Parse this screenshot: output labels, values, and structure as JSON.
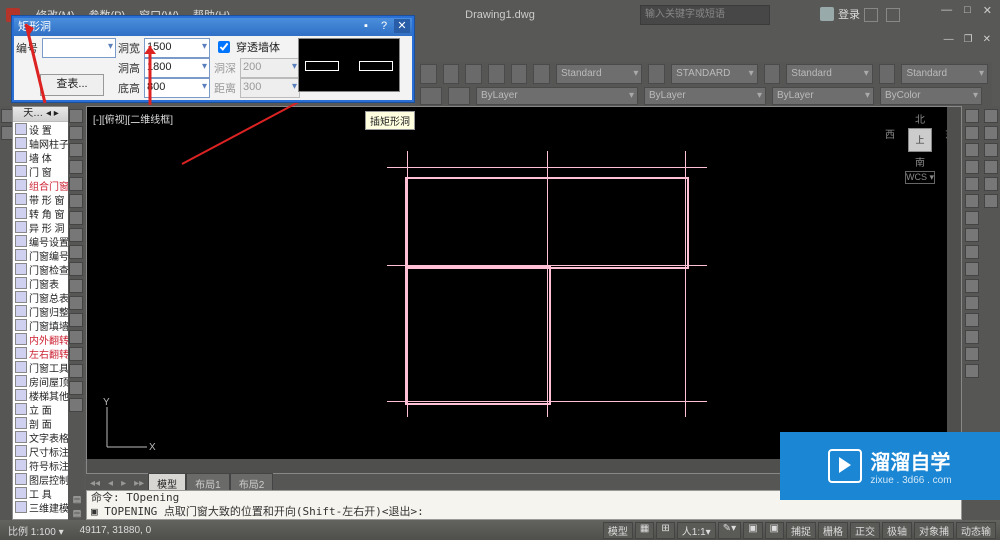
{
  "window": {
    "title": "Drawing1.dwg",
    "search_placeholder": "输入关键字或短语",
    "login": "登录"
  },
  "menus": [
    "修改(M)",
    "参数(P)",
    "窗口(W)",
    "帮助(H)"
  ],
  "dialog": {
    "title": "矩形洞",
    "labels": {
      "number": "编号",
      "width": "洞宽",
      "height": "洞高",
      "sill": "底高",
      "depth": "洞深",
      "dist": "距离"
    },
    "values": {
      "number": "",
      "width": "1500",
      "height": "1800",
      "sill": "800",
      "depth": "200",
      "dist": "300"
    },
    "checkbox": "穿透墙体",
    "button": "查表..."
  },
  "tooltip": "插矩形洞",
  "viewport_label": "[-][俯视][二维线框]",
  "compass": {
    "n": "北",
    "s": "南",
    "e": "东",
    "w": "西",
    "top": "上",
    "wcs": "WCS ▾"
  },
  "ucs_labels": {
    "x": "X",
    "y": "Y"
  },
  "styles": [
    "Standard",
    "STANDARD",
    "Standard",
    "Standard"
  ],
  "layers": [
    "ByLayer",
    "ByLayer",
    "ByLayer",
    "ByColor"
  ],
  "tabs": {
    "nav": [
      "◂◂",
      "◂",
      "▸",
      "▸▸"
    ],
    "model": "模型",
    "layout1": "布局1",
    "layout2": "布局2"
  },
  "command": {
    "line1": "命令: TOpening",
    "prompt_icon": "▣",
    "line2": "TOPENING 点取门窗大致的位置和开向(Shift-左右开)<退出>:"
  },
  "status": {
    "scale": "比例 1:100 ▾",
    "coords": "49117, 31880, 0",
    "right": [
      "模型",
      "▦",
      "⊞",
      "人1:1▾",
      "✎▾",
      "▣",
      "▣",
      "捕捉",
      "栅格",
      "正交",
      "极轴",
      "对象捕",
      "动态输"
    ]
  },
  "tree": {
    "header": "天…  ◂ ▸",
    "items": [
      {
        "a": "设",
        "b": "置"
      },
      {
        "a": "轴网柱子",
        "b": ""
      },
      {
        "a": "墙",
        "b": "体"
      },
      {
        "a": "门",
        "b": "窗"
      },
      {
        "a": "组合门窗",
        "b": "",
        "r": true
      },
      {
        "a": "带 形 窗",
        "b": ""
      },
      {
        "a": "转 角 窗",
        "b": ""
      },
      {
        "a": "异 形 洞",
        "b": ""
      },
      {
        "a": "编号设置",
        "b": ""
      },
      {
        "a": "门窗编号",
        "b": ""
      },
      {
        "a": "门窗检查",
        "b": ""
      },
      {
        "a": "门窗表",
        "b": ""
      },
      {
        "a": "门窗总表",
        "b": ""
      },
      {
        "a": "门窗归整",
        "b": ""
      },
      {
        "a": "门窗填墙",
        "b": ""
      },
      {
        "a": "内外翻转",
        "b": "",
        "r": true
      },
      {
        "a": "左右翻转",
        "b": "",
        "r": true
      },
      {
        "a": "门窗工具",
        "b": ""
      },
      {
        "a": "房间屋顶",
        "b": ""
      },
      {
        "a": "楼梯其他",
        "b": ""
      },
      {
        "a": "立",
        "b": "面"
      },
      {
        "a": "剖",
        "b": "面"
      },
      {
        "a": "文字表格",
        "b": ""
      },
      {
        "a": "尺寸标注",
        "b": ""
      },
      {
        "a": "符号标注",
        "b": ""
      },
      {
        "a": "图层控制",
        "b": ""
      },
      {
        "a": "工",
        "b": "具"
      },
      {
        "a": "三维建模",
        "b": ""
      }
    ]
  },
  "watermark": {
    "big": "溜溜自学",
    "small": "zixue . 3d66 . com"
  }
}
